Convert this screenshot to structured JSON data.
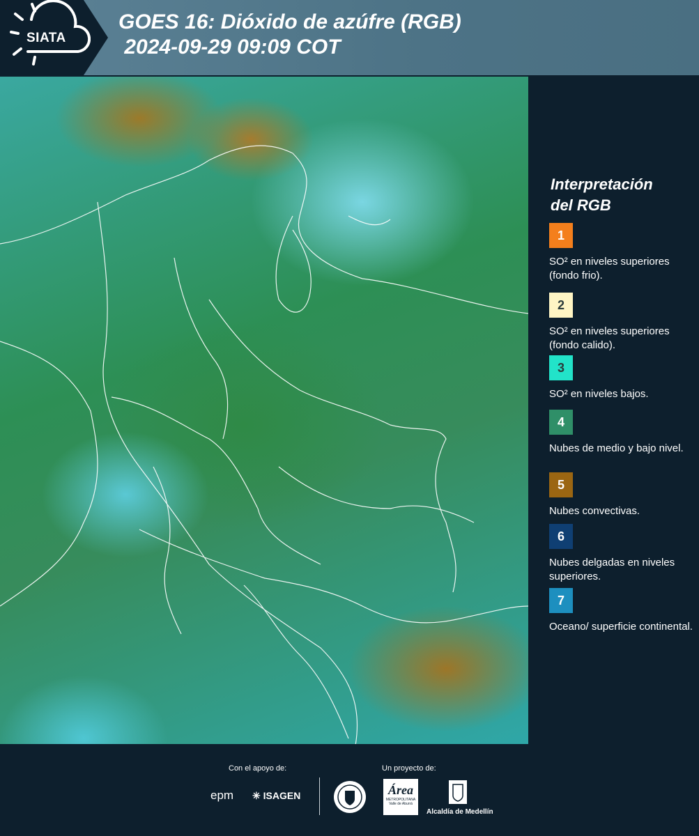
{
  "header": {
    "logo_text": "SIATA",
    "title_line1": "GOES 16: Dióxido de azúfre (RGB)",
    "title_line2": " 2024-09-29 09:09 COT"
  },
  "legend": {
    "title_line1": "Interpretación",
    "title_line2": "del RGB",
    "items": [
      {
        "num": "1",
        "color": "#f47f1c",
        "text": "SO² en niveles superiores (fondo frio)."
      },
      {
        "num": "2",
        "color": "#fff5c4",
        "text": "SO² en niveles superiores (fondo calido)."
      },
      {
        "num": "3",
        "color": "#22e3c9",
        "text": "SO² en niveles bajos."
      },
      {
        "num": "4",
        "color": "#2f8f68",
        "text": "Nubes de medio y bajo nivel."
      },
      {
        "num": "5",
        "color": "#9b6612",
        "text": "Nubes convectivas."
      },
      {
        "num": "6",
        "color": "#0f3f73",
        "text": "Nubes delgadas en niveles superiores."
      },
      {
        "num": "7",
        "color": "#1d8fbf",
        "text": "Oceano/ superficie continental."
      }
    ]
  },
  "footer": {
    "support_label": "Con el apoyo de:",
    "project_label": "Un proyecto de:",
    "epm": "epm",
    "isagen": "ISAGEN",
    "area": "Área",
    "area_sub1": "METROPOLITANA",
    "area_sub2": "Valle de Aburrá",
    "alcaldia": "Alcaldía de Medellín"
  }
}
